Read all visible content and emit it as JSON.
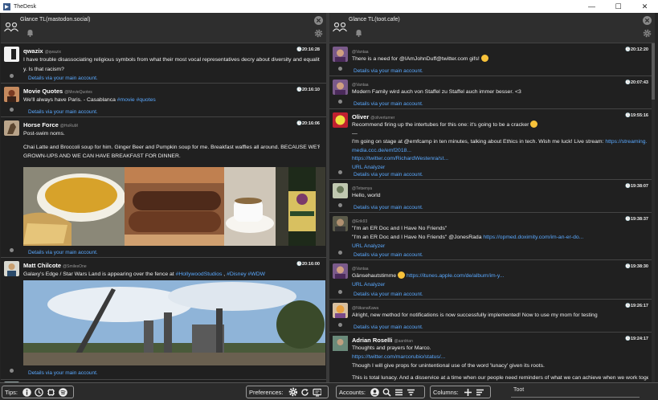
{
  "window": {
    "title": "TheDesk",
    "minimize": "—",
    "maximize": "☐",
    "close": "✕"
  },
  "left_column": {
    "title": "Glance TL(mastodon.social)",
    "toots": [
      {
        "name": "qwazix",
        "acct": "@qwazix",
        "time": "🕒20:16:28",
        "lines": [
          "I have trouble disassociating religious symbols from what their most vocal representatives decry about diversity and equalit",
          "y. Is that racism?"
        ],
        "via": "Details via your main account."
      },
      {
        "name": "Movie Quotes",
        "acct": "@MovieQuotes",
        "time": "🕒20:16:10",
        "text": "We'll always have Paris. - Casablanca ",
        "tags": "#movie #quotes",
        "via": "Details via your main account."
      },
      {
        "name": "Horse Force",
        "acct": "@HoRuM",
        "time": "🕒20:16:06",
        "lines": [
          "Post-swim noms.",
          "",
          "Chai Latte and Broccoli soup for him. Ginger Beer and Pumpkin soup for me. Breakfast waffles all around. BECAUSE WE'RE",
          "GROWN-UPS AND WE CAN HAVE BREAKFAST FOR DINNER."
        ],
        "via": "Details via your main account."
      },
      {
        "name": "Matt Chilcote",
        "acct": "@SmilesOne",
        "time": "🕒20:16:00",
        "text": "Galaxy's Edge / Star Wars Land is appearing over the fence at ",
        "link1": "#HollywoodStudios",
        "sep": " , ",
        "link2": "#Disney #WDW",
        "via": "Details via your main account."
      }
    ]
  },
  "right_column": {
    "title": "Glance TL(toot.cafe)",
    "toots": [
      {
        "acct": "@Vantaa",
        "time": "🕒20:12:20",
        "text": "There is a need for @IAmJohnDuff@twitter.com gifs!",
        "via": "Details via your main account."
      },
      {
        "acct": "@Vantaa",
        "time": "🕒20:07:43",
        "text": "Modern Family wird auch von Staffel zu Staffel auch immer besser. <3",
        "via": "Details via your main account."
      },
      {
        "name": "Oliver",
        "acct": "@oliverturner",
        "time": "🕒19:55:16",
        "l1": "Recommend firing up the intertubes for this one: it's going to be a cracker",
        "l2": "—",
        "l3": "I'm going on stage at @emfcamp in ten minutes, talking about Ethics in tech. Wish me luck! Live stream: ",
        "l3link": "https://streaming.",
        "l4": "media.ccc.de/emf2018...",
        "l5": "https://twitter.com/RichardWestenra/st...",
        "analyzer": "URL Analyzer",
        "via": "Details via your main account."
      },
      {
        "acct": "@Tetsenya",
        "time": "🕒19:38:07",
        "text": "Hello, world",
        "via": "Details via your main account."
      },
      {
        "acct": "@Erik93",
        "time": "🕒19:38:37",
        "l1": "\"I'm an ER Doc and I Have No Friends\"",
        "l2": "\"I'm an ER Doc and I Have No Friends\" @JonesRada ",
        "l2link": "https://opmed.doximity.com/im-an-er-do...",
        "analyzer": "URL Analyzer",
        "via": "Details via your main account."
      },
      {
        "acct": "@Vantaa",
        "time": "🕒19:38:30",
        "text": "Gänsehautstimme ",
        "link": "https://itunes.apple.com/de/album/im-y...",
        "analyzer": "URL Analyzer",
        "via": "Details via your main account."
      },
      {
        "acct": "@NikanaKawa",
        "time": "🕒19:26:17",
        "text": "Alright, new method for notifications is now successfully implemented! Now to use my mom for testing",
        "via": "Details via your main account."
      },
      {
        "name": "Adrian Roselli",
        "acct": "@aardrian",
        "time": "🕒19:24:17",
        "l1": "Thoughts and prayers for Marco.",
        "l2": "https://twitter.com/marcorubio/status/...",
        "l3": "Though I will give props for unintentional use of the word 'lunacy' given its roots.",
        "l4": "This is total lunacy. And a disservice at a time when our people need reminders of what we can achieve when we work toget"
      }
    ]
  },
  "footer": {
    "tips_label": "Tips:",
    "preferences_label": "Preferences:",
    "accounts_label": "Accounts:",
    "columns_label": "Columns:",
    "toot_placeholder": "Toot"
  },
  "icons": [
    "users-icon",
    "bell-icon",
    "close-icon",
    "gear-icon",
    "globe-icon",
    "clock-icon",
    "info-icon",
    "refresh-icon",
    "search-icon",
    "plus-icon",
    "filter-icon",
    "list-icon"
  ]
}
